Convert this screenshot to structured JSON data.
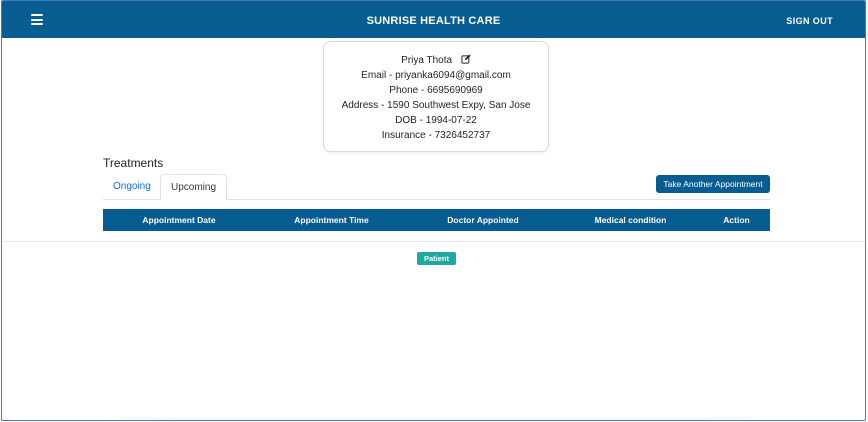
{
  "header": {
    "menu_icon": "hamburger-icon",
    "title": "SUNRISE HEALTH CARE",
    "sign_out_label": "SIGN OUT"
  },
  "profile": {
    "name": "Priya Thota",
    "edit_icon": "edit-icon",
    "email": "Email - priyanka6094@gmail.com",
    "phone": "Phone - 6695690969",
    "address": "Address - 1590 Southwest Expy, San Jose",
    "dob": "DOB - 1994-07-22",
    "insurance": "Insurance - 7326452737"
  },
  "treatments": {
    "title": "Treatments",
    "tabs": [
      {
        "label": "Ongoing",
        "active": false
      },
      {
        "label": "Upcoming",
        "active": true
      }
    ],
    "take_appointment_label": "Take Another Appointment",
    "columns": [
      "Appointment Date",
      "Appointment Time",
      "Doctor Appointed",
      "Medical condition",
      "Action"
    ],
    "rows": []
  },
  "role_badge": "Patient",
  "colors": {
    "primary": "#075c92",
    "link": "#0d6efd",
    "badge": "#20a8a0"
  }
}
